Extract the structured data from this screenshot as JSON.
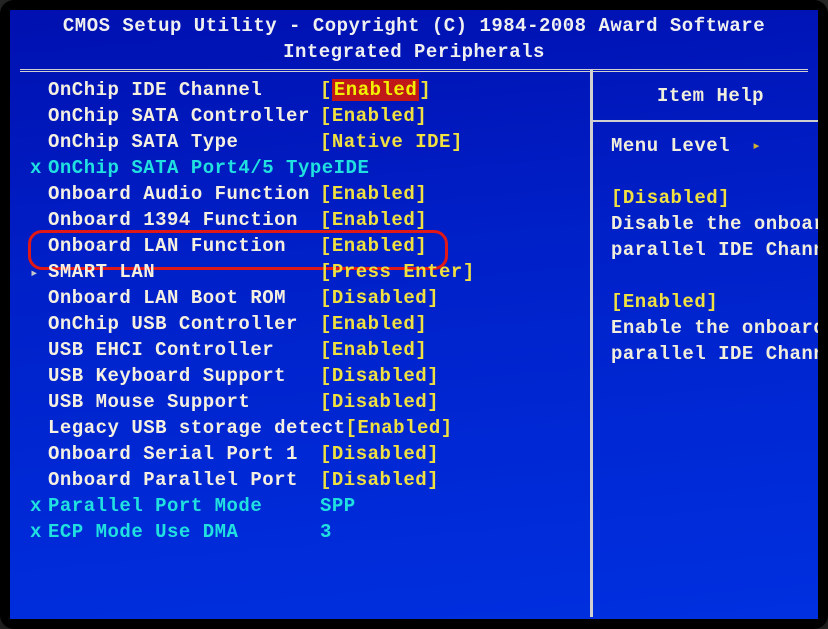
{
  "header": {
    "title": "CMOS Setup Utility - Copyright (C) 1984-2008 Award Software",
    "subtitle": "Integrated Peripherals"
  },
  "settings": [
    {
      "prefix": "",
      "label": "OnChip IDE Channel",
      "value": "Enabled",
      "bracket": true,
      "style": "highlight"
    },
    {
      "prefix": "",
      "label": "OnChip SATA Controller",
      "value": "Enabled",
      "bracket": true,
      "style": ""
    },
    {
      "prefix": "",
      "label": "OnChip SATA Type",
      "value": "Native IDE",
      "bracket": true,
      "style": ""
    },
    {
      "prefix": "x",
      "label": "OnChip SATA Port4/5 Type",
      "value": "IDE",
      "bracket": false,
      "style": "disabled"
    },
    {
      "prefix": "",
      "label": "Onboard Audio Function",
      "value": "Enabled",
      "bracket": true,
      "style": ""
    },
    {
      "prefix": "",
      "label": "Onboard 1394 Function",
      "value": "Enabled",
      "bracket": true,
      "style": ""
    },
    {
      "prefix": "",
      "label": "Onboard LAN Function",
      "value": "Enabled",
      "bracket": true,
      "style": "boxed"
    },
    {
      "prefix": "",
      "label": "SMART LAN",
      "value": "Press Enter",
      "bracket": true,
      "style": "arrow"
    },
    {
      "prefix": "",
      "label": "Onboard LAN Boot ROM",
      "value": "Disabled",
      "bracket": true,
      "style": ""
    },
    {
      "prefix": "",
      "label": "OnChip USB Controller",
      "value": "Enabled",
      "bracket": true,
      "style": ""
    },
    {
      "prefix": "",
      "label": "USB EHCI Controller",
      "value": "Enabled",
      "bracket": true,
      "style": ""
    },
    {
      "prefix": "",
      "label": "USB Keyboard Support",
      "value": "Disabled",
      "bracket": true,
      "style": ""
    },
    {
      "prefix": "",
      "label": "USB Mouse Support",
      "value": "Disabled",
      "bracket": true,
      "style": ""
    },
    {
      "prefix": "",
      "label": "Legacy USB storage detect",
      "value": "Enabled",
      "bracket": true,
      "style": ""
    },
    {
      "prefix": "",
      "label": "Onboard Serial Port 1",
      "value": "Disabled",
      "bracket": true,
      "style": ""
    },
    {
      "prefix": "",
      "label": "Onboard Parallel Port",
      "value": "Disabled",
      "bracket": true,
      "style": ""
    },
    {
      "prefix": "x",
      "label": "Parallel Port Mode",
      "value": "SPP",
      "bracket": false,
      "style": "disabled"
    },
    {
      "prefix": "x",
      "label": "ECP Mode Use DMA",
      "value": "3",
      "bracket": false,
      "style": "disabled"
    }
  ],
  "help": {
    "title": "Item Help",
    "menu_level_label": "Menu Level",
    "sections": [
      {
        "heading": "[Disabled]",
        "lines": [
          "Disable the onboar",
          "parallel IDE Chann"
        ]
      },
      {
        "heading": "[Enabled]",
        "lines": [
          "Enable the onboard",
          "parallel IDE Chann"
        ]
      }
    ]
  }
}
